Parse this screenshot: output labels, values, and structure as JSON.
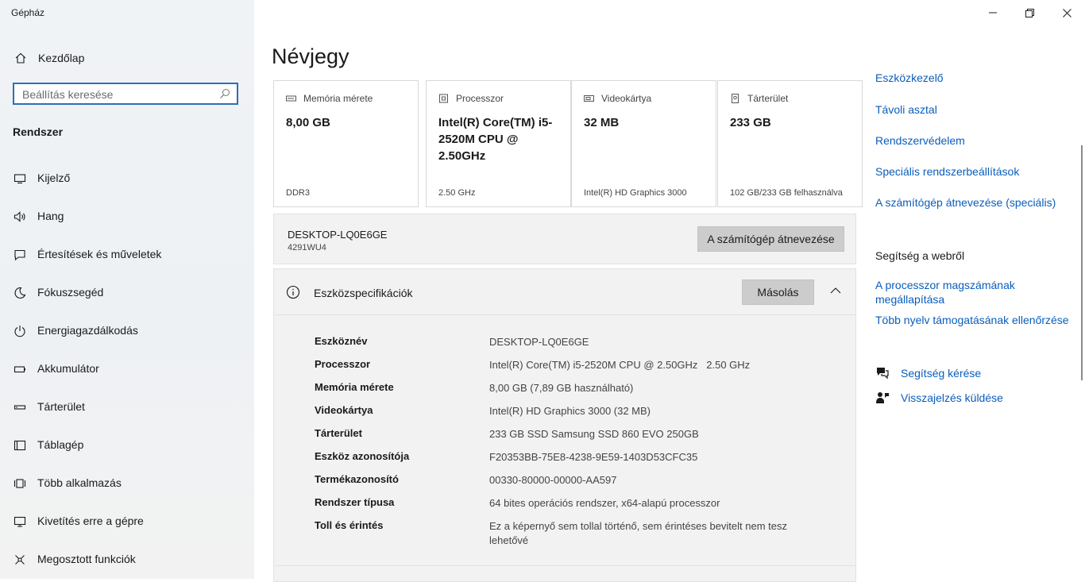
{
  "app": {
    "title": "Gépház"
  },
  "sidebar": {
    "home_label": "Kezdőlap",
    "search_placeholder": "Beállítás keresése",
    "section": "Rendszer",
    "items": [
      {
        "label": "Kijelző",
        "icon": "display-icon"
      },
      {
        "label": "Hang",
        "icon": "speaker-icon"
      },
      {
        "label": "Értesítések és műveletek",
        "icon": "notification-icon"
      },
      {
        "label": "Fókuszsegéd",
        "icon": "moon-icon"
      },
      {
        "label": "Energiagazdálkodás",
        "icon": "power-icon"
      },
      {
        "label": "Akkumulátor",
        "icon": "battery-icon"
      },
      {
        "label": "Tárterület",
        "icon": "storage-icon"
      },
      {
        "label": "Táblagép",
        "icon": "tablet-icon"
      },
      {
        "label": "Több alkalmazás",
        "icon": "multitasking-icon"
      },
      {
        "label": "Kivetítés erre a gépre",
        "icon": "projecting-icon"
      },
      {
        "label": "Megosztott funkciók",
        "icon": "shared-icon"
      }
    ]
  },
  "main": {
    "title": "Névjegy",
    "cards": [
      {
        "label": "Memória mérete",
        "value": "8,00 GB",
        "footer": "DDR3",
        "icon": "memory-icon"
      },
      {
        "label": "Processzor",
        "value": "Intel(R) Core(TM) i5-2520M CPU @ 2.50GHz",
        "footer": "2.50 GHz",
        "icon": "processor-icon"
      },
      {
        "label": "Videokártya",
        "value": "32 MB",
        "footer": "Intel(R) HD Graphics 3000",
        "icon": "gpu-icon"
      },
      {
        "label": "Tárterület",
        "value": "233 GB",
        "footer": "102 GB/233 GB felhasználva",
        "icon": "disk-icon"
      }
    ],
    "pc": {
      "name": "DESKTOP-LQ0E6GE",
      "model": "4291WU4",
      "rename_button": "A számítógép átnevezése"
    },
    "specs": {
      "title": "Eszközspecifikációk",
      "copy_button": "Másolás",
      "rows": [
        {
          "key": "Eszköznév",
          "value": "DESKTOP-LQ0E6GE"
        },
        {
          "key": "Processzor",
          "value": "Intel(R) Core(TM) i5-2520M CPU @ 2.50GHz   2.50 GHz"
        },
        {
          "key": "Memória mérete",
          "value": "8,00 GB (7,89 GB használható)"
        },
        {
          "key": "Videokártya",
          "value": "Intel(R) HD Graphics 3000 (32 MB)"
        },
        {
          "key": "Tárterület",
          "value": "233 GB SSD Samsung SSD 860 EVO 250GB"
        },
        {
          "key": "Eszköz azonosítója",
          "value": "F20353BB-75E8-4238-9E59-1403D53CFC35"
        },
        {
          "key": "Termékazonosító",
          "value": "00330-80000-00000-AA597"
        },
        {
          "key": "Rendszer típusa",
          "value": "64 bites operációs rendszer, x64-alapú processzor"
        },
        {
          "key": "Toll és érintés",
          "value": "Ez a képernyő sem tollal történő, sem érintéses bevitelt nem tesz lehetővé"
        }
      ]
    }
  },
  "right": {
    "links": [
      "Eszközkezelő",
      "Távoli asztal",
      "Rendszervédelem",
      "Speciális rendszerbeállítások",
      "A számítógép átnevezése (speciális)"
    ],
    "web_help_title": "Segítség a webről",
    "web_links": [
      "A processzor magszámának megállapítása",
      "Több nyelv támogatásának ellenőrzése"
    ],
    "get_help": "Segítség kérése",
    "feedback": "Visszajelzés küldése"
  },
  "colors": {
    "accent": "#0a5dbb",
    "search_border": "#2b6fb8",
    "button": "#cccccc",
    "panel": "#f2f2f2"
  }
}
